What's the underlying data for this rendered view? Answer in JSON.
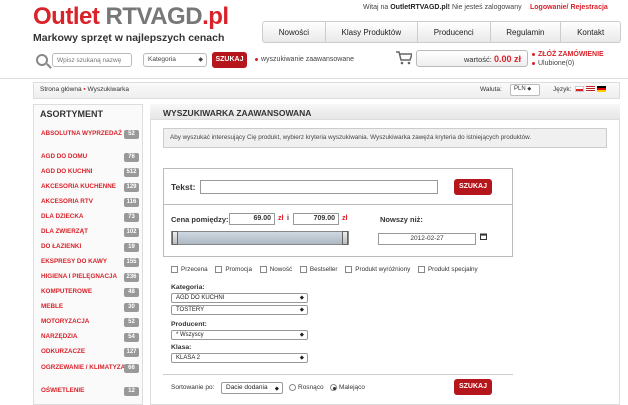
{
  "brand": {
    "logo_part1": "Outlet ",
    "logo_part2": "RTVAGD",
    "logo_part3": ".pl",
    "tagline": "Markowy sprzęt w najlepszych cenach"
  },
  "topbar": {
    "welcome_prefix": "Witaj na ",
    "site": "OutletRTVAGD.pl!",
    "welcome_suffix": " Nie jesteś zalogowany",
    "login_link": "Logowanie/ Rejestracja"
  },
  "nav": [
    "Nowości",
    "Klasy Produktów",
    "Producenci",
    "Regulamin",
    "Kontakt"
  ],
  "search": {
    "placeholder": "Wpisz szukaną nazwę",
    "category": "Kategoria",
    "button": "SZUKAJ",
    "advanced_link": "wyszukiwanie zaawansowane"
  },
  "cart": {
    "label": "wartość: ",
    "value": "0.00 zł",
    "order_link": "ZŁÓŻ ZAMÓWIENIE",
    "favorites_link": "Ulubione(0)"
  },
  "breadcrumb": {
    "home": "Strona główna",
    "current": "Wyszukiwarka"
  },
  "currency": {
    "label": "Waluta:",
    "value": "PLN"
  },
  "language": {
    "label": "Język:"
  },
  "sidebar": {
    "title": "ASORTYMENT",
    "items": [
      {
        "label": "ABSOLUTNA WYPRZEDAŻ",
        "count": "52"
      },
      {
        "label": "AGD DO DOMU",
        "count": "76"
      },
      {
        "label": "AGD DO KUCHNI",
        "count": "512"
      },
      {
        "label": "AKCESORIA KUCHENNE",
        "count": "129"
      },
      {
        "label": "AKCESORIA RTV",
        "count": "116"
      },
      {
        "label": "DLA DZIECKA",
        "count": "73"
      },
      {
        "label": "DLA ZWIERZĄT",
        "count": "102"
      },
      {
        "label": "DO ŁAZIENKI",
        "count": "19"
      },
      {
        "label": "EKSPRESY DO KAWY",
        "count": "155"
      },
      {
        "label": "HIGIENA I PIELĘGNACJA",
        "count": "236"
      },
      {
        "label": "KOMPUTEROWE",
        "count": "48"
      },
      {
        "label": "MEBLE",
        "count": "30"
      },
      {
        "label": "MOTORYZACJA",
        "count": "52"
      },
      {
        "label": "NARZĘDZIA",
        "count": "54"
      },
      {
        "label": "ODKURZACZE",
        "count": "127"
      },
      {
        "label": "OGRZEWANIE / KLIMATYZACJA",
        "count": "66"
      },
      {
        "label": "OŚWIETLENIE",
        "count": "12"
      }
    ]
  },
  "main": {
    "title": "WYSZUKIWARKA ZAAWANSOWANA",
    "info": "Aby wyszukać interesujący Cię produkt, wybierz kryteria wyszukiwania. Wyszukiwarka zawęża kryteria do istniejących produktów.",
    "text_label": "Tekst:",
    "text_value": "",
    "search_button": "SZUKAJ",
    "price_label": "Cena pomiędzy:",
    "price_from": "69.00",
    "price_to": "709.00",
    "price_from_range_fraction": 0.0,
    "price_to_range_fraction": 1.0,
    "currency_unit": "zł",
    "and_label": "i",
    "newer_label": "Nowszy niż:",
    "newer_value": "2012-02-27",
    "checkboxes": [
      "Przecena",
      "Promocja",
      "Nowość",
      "Bestseller",
      "Produkt wyróżniony",
      "Produkt specjalny"
    ],
    "category_label": "Kategoria:",
    "category_value": "AGD DO KUCHNI",
    "subcategory_value": "TOSTERY",
    "producer_label": "Producent:",
    "producer_value": "* Wszyscy",
    "class_label": "Klasa:",
    "class_value": "KLASA 2",
    "sort_label": "Sortowanie po:",
    "sort_value": "Dacie dodania",
    "sort_asc": "Rosnąco",
    "sort_desc": "Malejąco",
    "bottom_button": "SZUKAJ"
  },
  "colors": {
    "brand_red": "#d9222a",
    "button_red": "#b5161b"
  }
}
